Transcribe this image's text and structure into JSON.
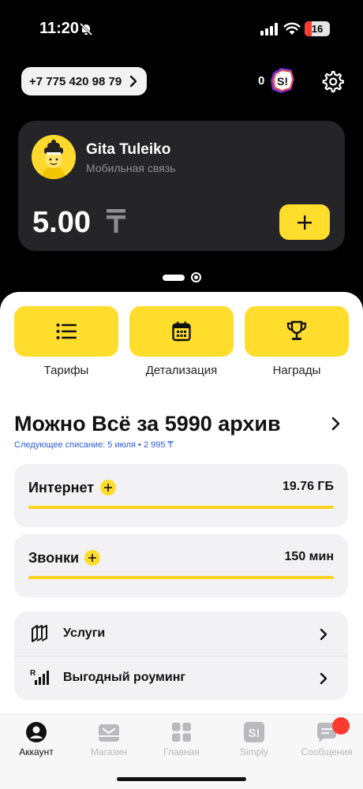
{
  "status_bar": {
    "time": "11:20",
    "battery": "16"
  },
  "header": {
    "phone": "+7 775 420 98 79",
    "points": "0",
    "badge_text": "S!"
  },
  "account_card": {
    "name": "Gita Tuleiko",
    "subtitle": "Мобильная связь",
    "balance": "5.00",
    "currency_icon": "tenge-icon",
    "topup_icon": "plus-icon"
  },
  "quick_actions": [
    {
      "label": "Тарифы",
      "icon": "list-icon"
    },
    {
      "label": "Детализация",
      "icon": "calendar-icon"
    },
    {
      "label": "Награды",
      "icon": "trophy-icon"
    }
  ],
  "plan": {
    "title": "Можно Всё за 5990 архив",
    "next_charge": "Следующее списание: 5 июля • 2 995 ₸"
  },
  "usage": [
    {
      "label": "Интернет",
      "value": "19.76 ГБ",
      "fill": 1.0
    },
    {
      "label": "Звонки",
      "value": "150 мин",
      "fill": 1.0
    }
  ],
  "menu": [
    {
      "label": "Услуги",
      "icon": "services-icon"
    },
    {
      "label": "Выгодный роуминг",
      "icon": "roaming-icon"
    }
  ],
  "tabs": [
    {
      "label": "Аккаунт",
      "icon": "account-icon",
      "active": true
    },
    {
      "label": "Магазин",
      "icon": "shop-icon",
      "active": false
    },
    {
      "label": "Главная",
      "icon": "home-grid-icon",
      "active": false
    },
    {
      "label": "Simply",
      "icon": "simply-icon",
      "active": false
    },
    {
      "label": "Сообщения",
      "icon": "messages-icon",
      "active": false
    }
  ],
  "colors": {
    "accent": "#FFDD2D",
    "background": "#000000",
    "card": "#252528",
    "link": "#2A5BD7"
  }
}
